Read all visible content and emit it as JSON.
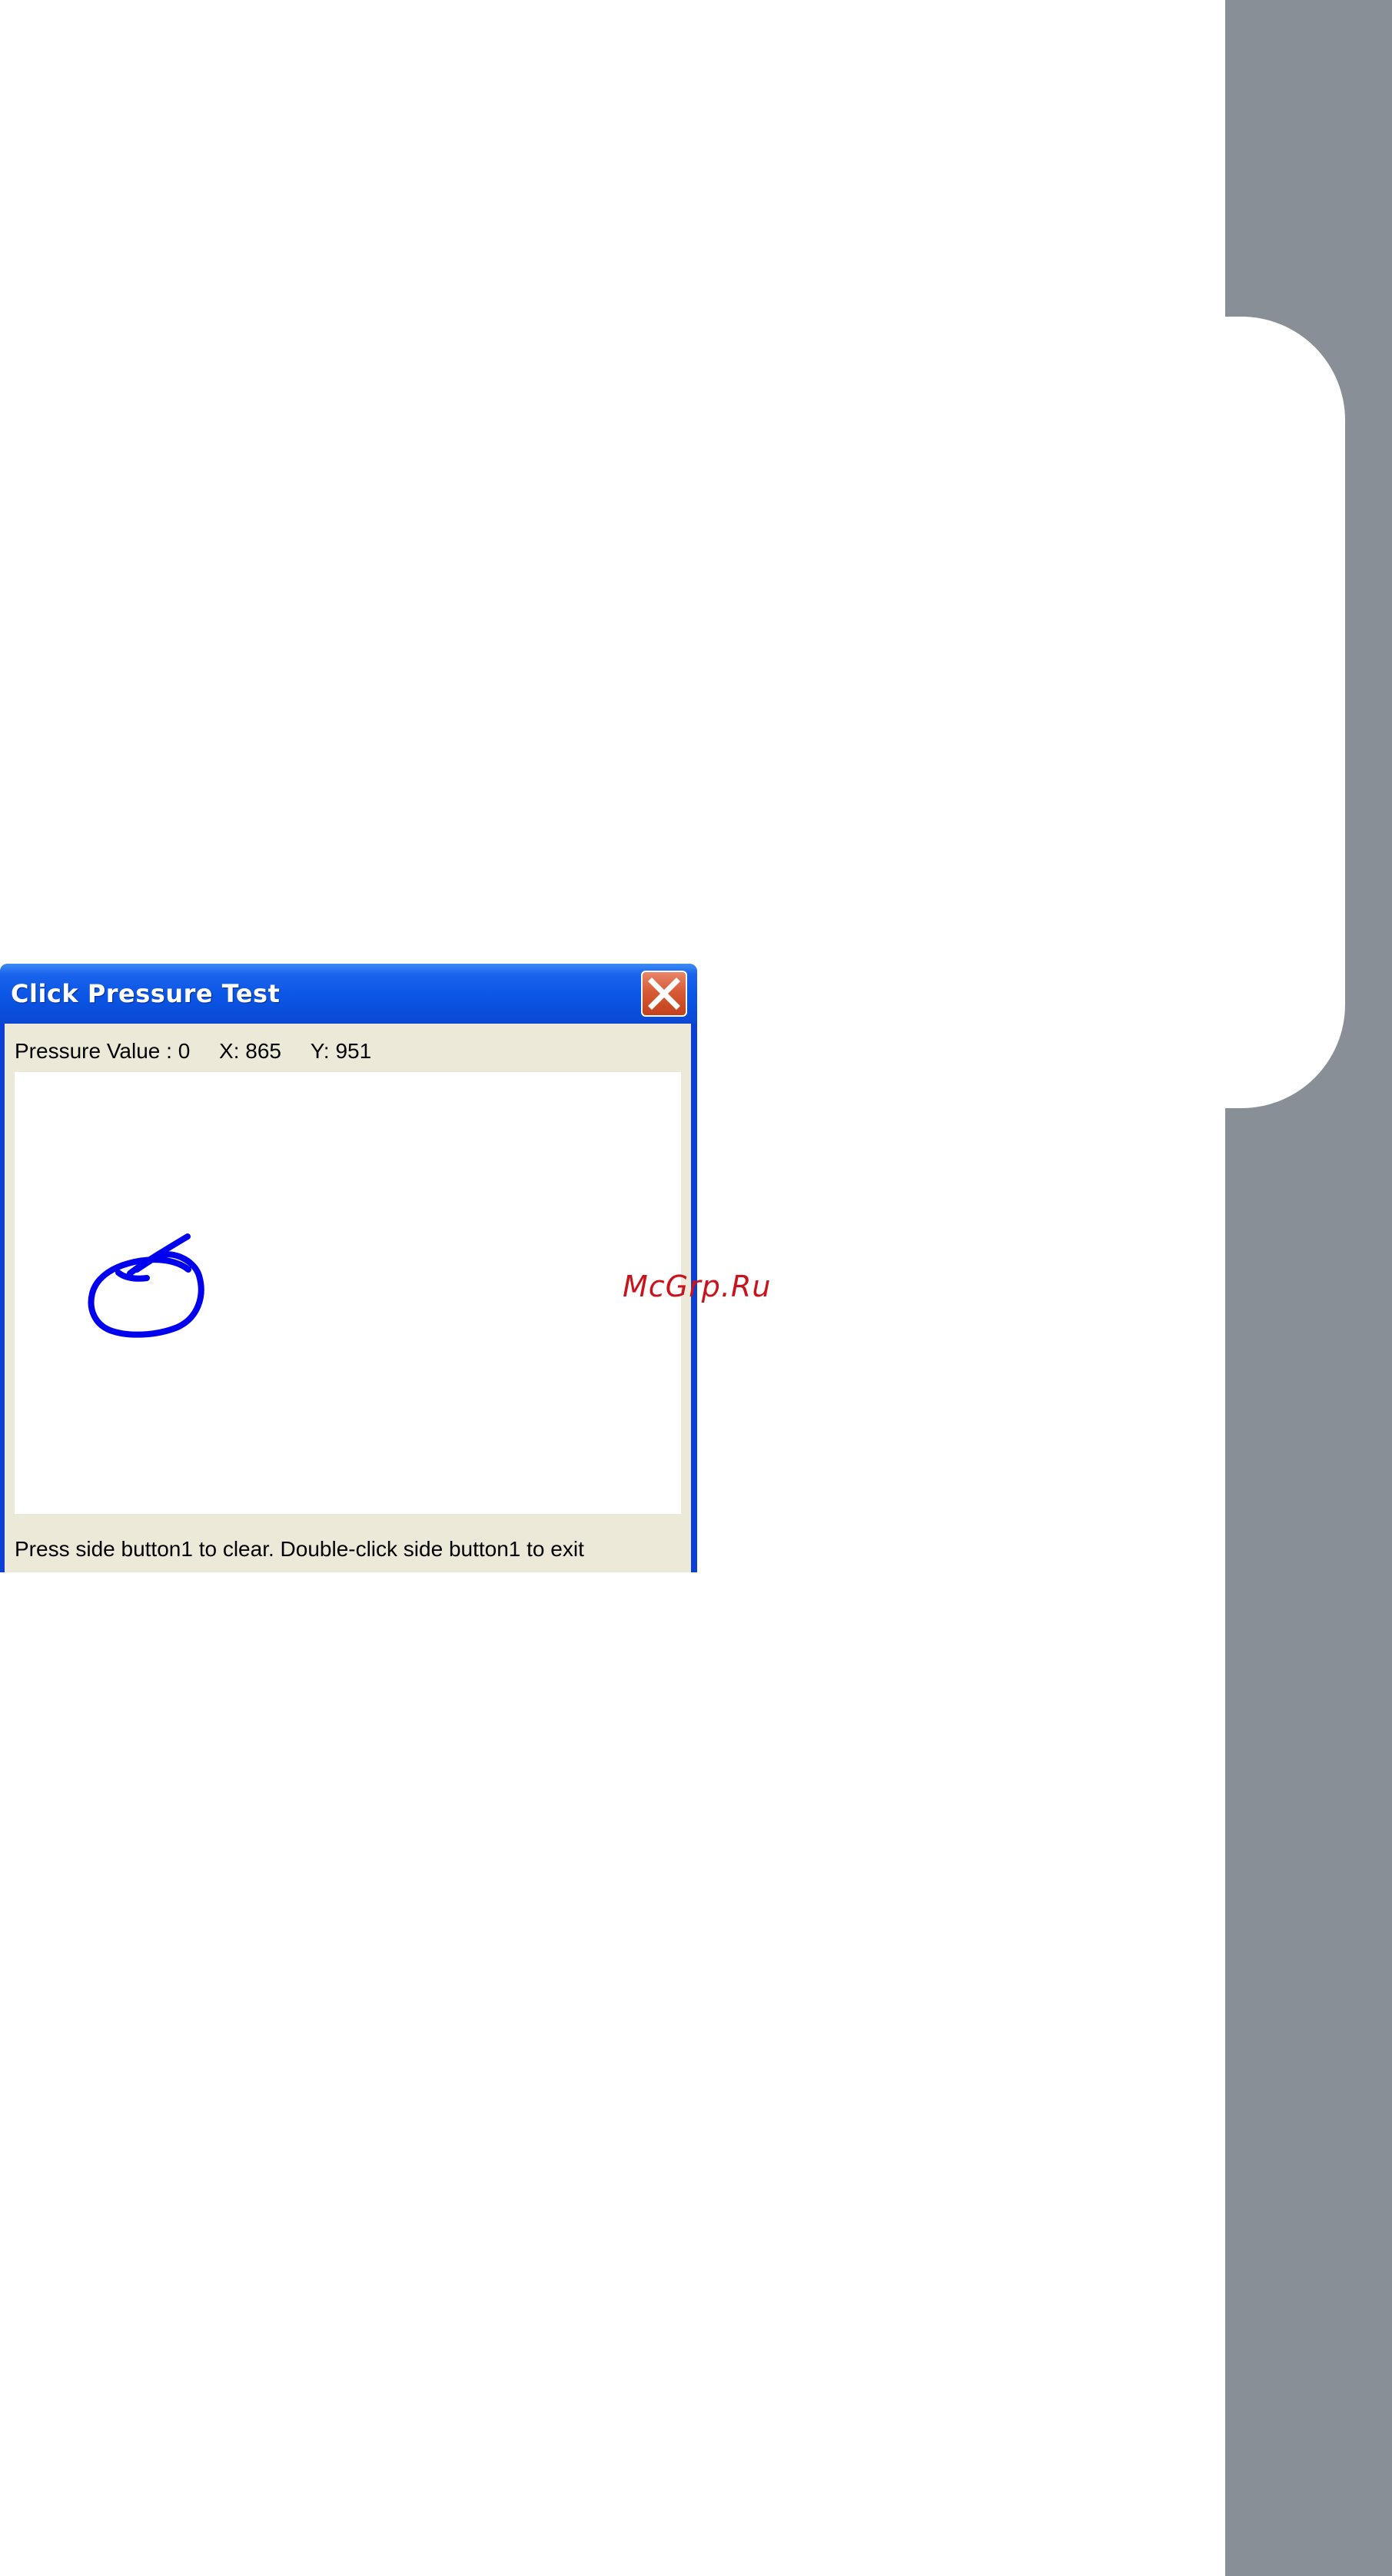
{
  "window": {
    "title": "Click Pressure Test",
    "close_icon": "close-x-icon"
  },
  "readout": {
    "pressure_label": "Pressure Value : 0",
    "x_label": "X: 865",
    "y_label": "Y: 951"
  },
  "canvas": {
    "stroke_color": "#0000ee"
  },
  "footer": {
    "instructions": "Press side button1 to clear. Double-click side button1 to exit"
  },
  "watermark": {
    "text": "McGrp.Ru"
  },
  "colors": {
    "titlebar": "#0b55e6",
    "client_bg": "#ece9d8",
    "side_strip": "#898f96",
    "watermark": "#c8141c",
    "close_button": "#d85a36"
  }
}
